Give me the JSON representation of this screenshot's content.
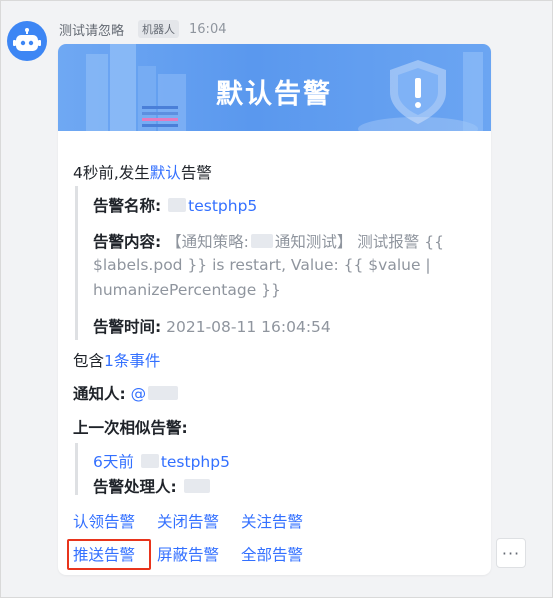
{
  "message": {
    "sender": "测试请忽略",
    "badge": "机器人",
    "time": "16:04"
  },
  "card": {
    "banner_title": "默认告警",
    "intro_prefix": "4秒前,发生",
    "intro_link": "默认",
    "intro_suffix": "告警",
    "alert_name_label": "告警名称:",
    "alert_name_value": "testphp5",
    "alert_content_label": "告警内容:",
    "alert_content_line1": "【通知策略:",
    "alert_content_line1b": "通知测试】 测试报警 {{",
    "alert_content_line2": "$labels.pod }} is restart, Value: {{ $value |",
    "alert_content_line3": "humanizePercentage }}",
    "alert_time_label": "告警时间:",
    "alert_time_value": "2021-08-11 16:04:54",
    "contains_prefix": "包含",
    "contains_link": "1条事件",
    "notify_label": "通知人:",
    "notify_value": "@",
    "last_similar_label": "上一次相似告警:",
    "last_link_prefix": "6天前",
    "last_link_value": "testphp5",
    "handler_label": "告警处理人:"
  },
  "actions": {
    "claim": "认领告警",
    "close": "关闭告警",
    "follow": "关注告警",
    "push": "推送告警",
    "mute": "屏蔽告警",
    "all": "全部告警"
  },
  "more": "···",
  "colors": {
    "link": "#3370ff",
    "highlight_border": "#e8341c",
    "banner": "#5a98ee"
  }
}
